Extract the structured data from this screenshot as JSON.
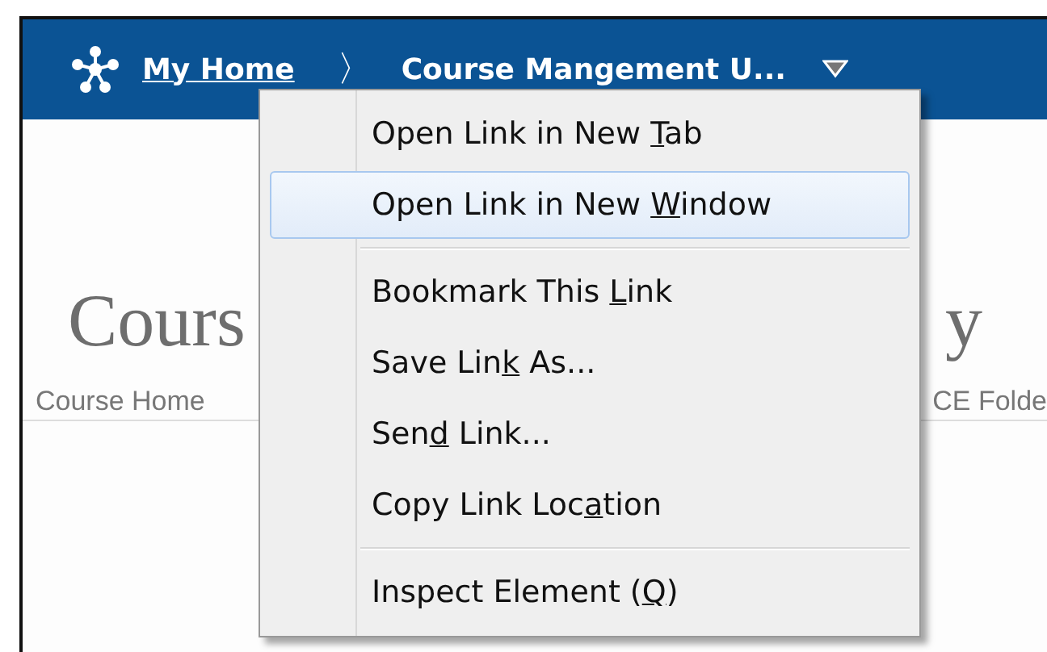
{
  "header": {
    "home_link": "My Home",
    "separator": "〉",
    "course_title": "Course Mangement U..."
  },
  "page": {
    "heading_left": "Cours",
    "heading_right": "y",
    "nav_left": "Course Home",
    "nav_right": "CE Folde"
  },
  "context_menu": {
    "groups": [
      {
        "items": [
          {
            "before": "Open Link in New ",
            "key": "T",
            "after": "ab",
            "selected": false
          },
          {
            "before": "Open Link in New ",
            "key": "W",
            "after": "indow",
            "selected": true
          }
        ]
      },
      {
        "items": [
          {
            "before": "Bookmark This ",
            "key": "L",
            "after": "ink",
            "selected": false
          },
          {
            "before": "Save Lin",
            "key": "k",
            "after": " As...",
            "selected": false
          },
          {
            "before": "Sen",
            "key": "d",
            "after": " Link...",
            "selected": false
          },
          {
            "before": "Copy Link Loc",
            "key": "a",
            "after": "tion",
            "selected": false
          }
        ]
      },
      {
        "items": [
          {
            "before": "Inspect Element (",
            "key": "Q",
            "after": ")",
            "selected": false
          }
        ]
      }
    ]
  }
}
